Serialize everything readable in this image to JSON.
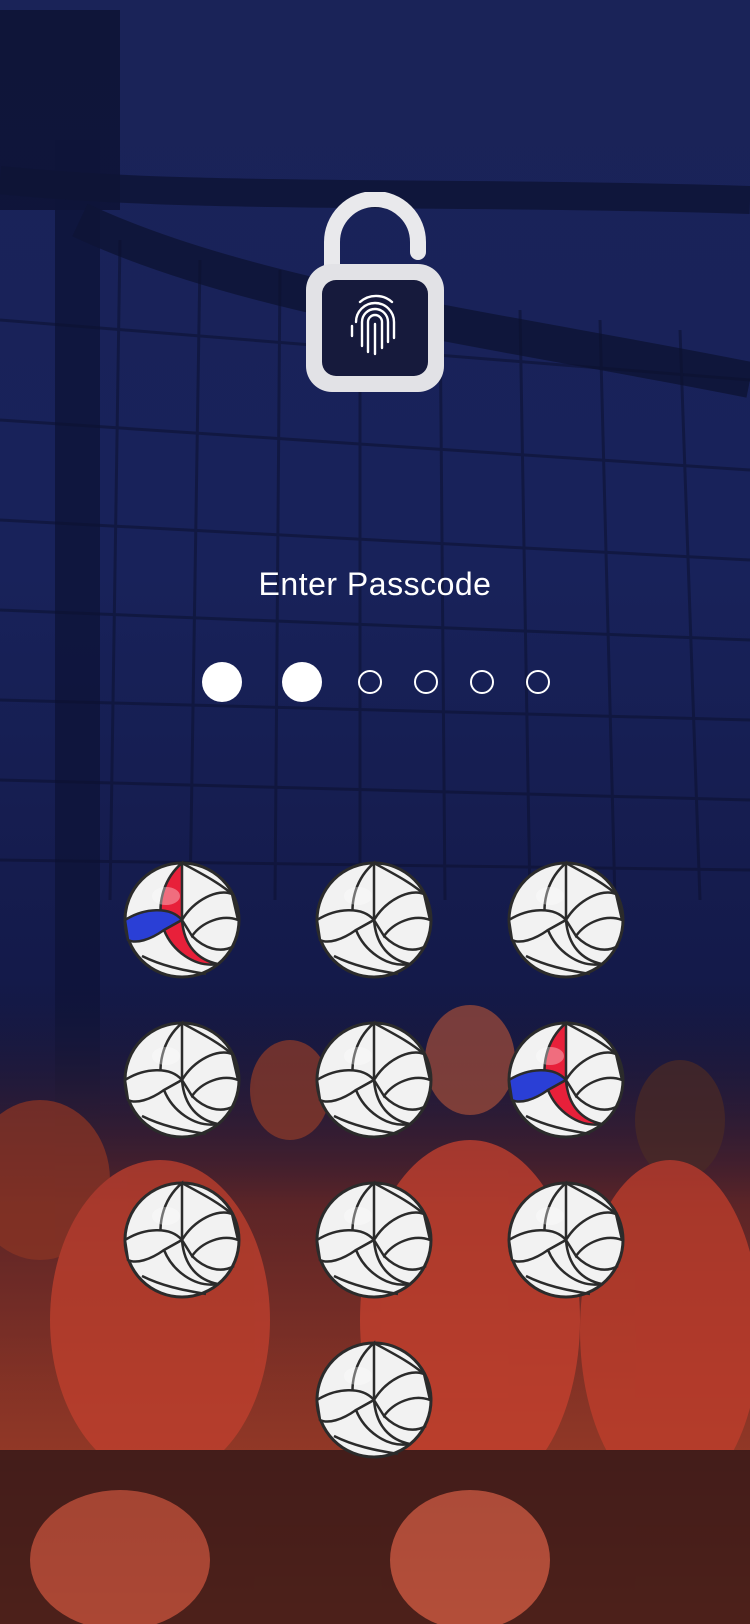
{
  "lock_screen": {
    "title": "Enter Passcode",
    "passcode": {
      "length": 6,
      "entered": 2
    },
    "lock_icon": "fingerprint-padlock-icon",
    "keys": [
      {
        "name": "key-1",
        "style": "tricolor"
      },
      {
        "name": "key-2",
        "style": "white"
      },
      {
        "name": "key-3",
        "style": "white"
      },
      {
        "name": "key-4",
        "style": "white"
      },
      {
        "name": "key-5",
        "style": "white"
      },
      {
        "name": "key-6",
        "style": "tricolor"
      },
      {
        "name": "key-7",
        "style": "white"
      },
      {
        "name": "key-8",
        "style": "white"
      },
      {
        "name": "key-9",
        "style": "white"
      },
      {
        "name": "key-0",
        "style": "white"
      }
    ]
  },
  "colors": {
    "background": "#18225a",
    "ball_red": "#e8203a",
    "ball_blue": "#2a3fd6",
    "ball_white": "#f2f2f2"
  }
}
